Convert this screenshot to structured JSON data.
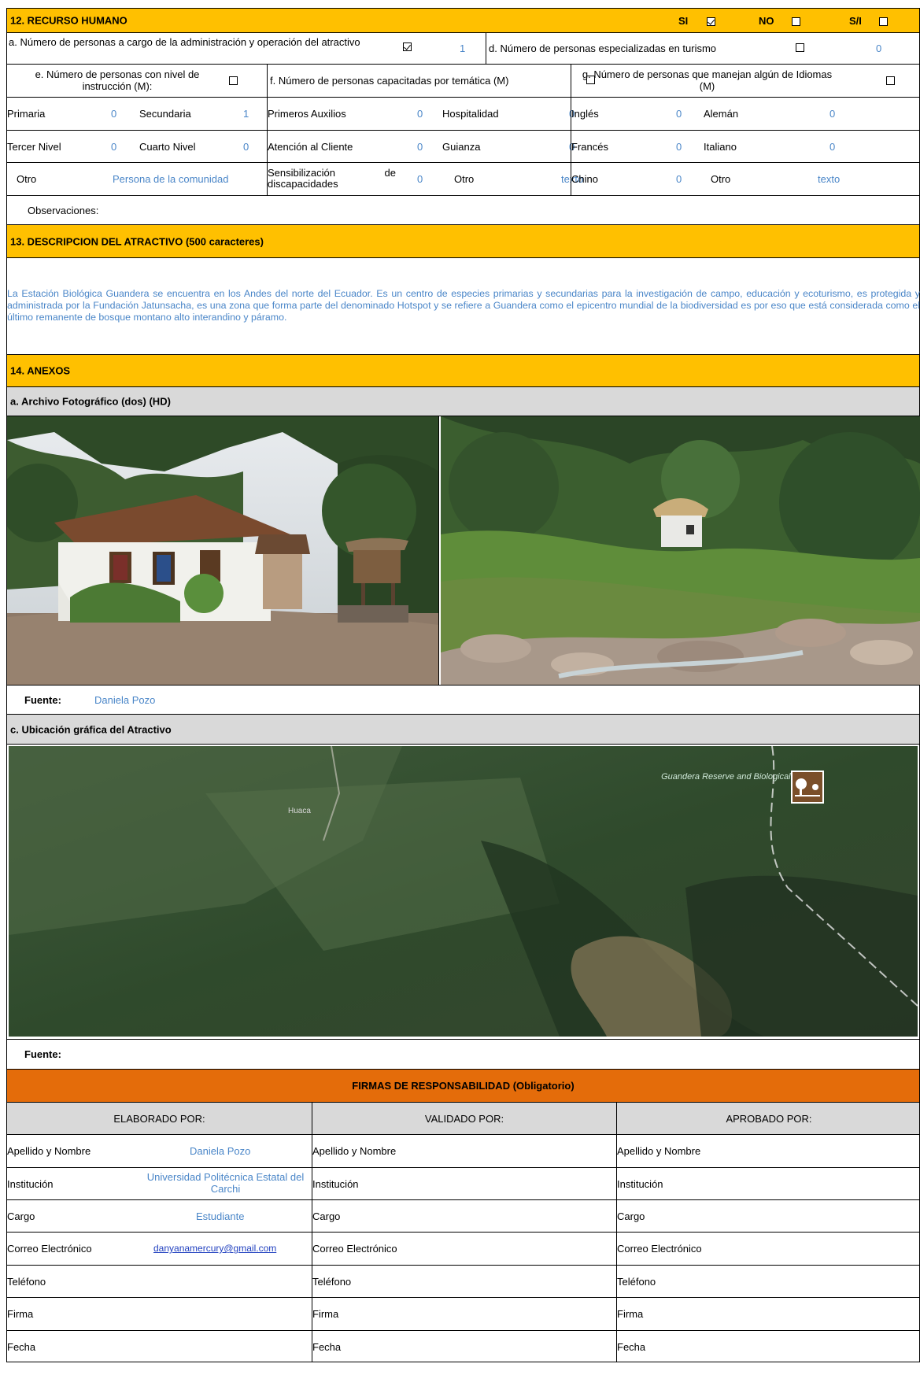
{
  "s12": {
    "title": "12. RECURSO HUMANO",
    "si": "SI",
    "no": "NO",
    "sn": "S/I",
    "a_label": "a. Número de personas a cargo de la administración y operación del atractivo",
    "a_value": "1",
    "d_label": "d. Número de personas especializadas en turismo",
    "d_value": "0",
    "e_label": "e. Número de personas con nivel de instrucción (M):",
    "f_label": "f. Número de personas capacitadas por temática (M)",
    "g_label": "g. Número de personas que manejan algún de Idiomas (M)",
    "rows": [
      [
        "Primaria",
        "0",
        "Secundaria",
        "1",
        "Primeros Auxilios",
        "0",
        "Hospitalidad",
        "0",
        "Inglés",
        "0",
        "Alemán",
        "0"
      ],
      [
        "Tercer Nivel",
        "0",
        "Cuarto Nivel",
        "0",
        "Atención al Cliente",
        "0",
        "Guianza",
        "0",
        "Francés",
        "0",
        "Italiano",
        "0"
      ],
      [
        "Otro",
        "Persona de la comunidad",
        "",
        "",
        "Sensibilización de discapacidades",
        "0",
        "Otro",
        "texto",
        "Chino",
        "0",
        "Otro",
        "texto"
      ]
    ],
    "observaciones": "Observaciones:"
  },
  "s13": {
    "title": "13. DESCRIPCION DEL ATRACTIVO (500 caracteres)",
    "text": "La Estación Biológica Guandera se encuentra en los Andes del norte del Ecuador. Es un centro de especies primarias y secundarias para la investigación de campo, educación y ecoturismo, es protegida y administrada por la Fundación Jatunsacha, es una zona que forma parte del denominado Hotspot  y se refiere a Guandera como el epicentro mundial de la biodiversidad es por eso que está considerada como el último remanente de bosque montano alto interandino y páramo."
  },
  "s14": {
    "title": "14. ANEXOS",
    "photo_title": "a. Archivo Fotográfico (dos) (HD)",
    "fuente_label": "Fuente:",
    "fuente_value": "Daniela Pozo",
    "map_title": "c. Ubicación gráfica del Atractivo",
    "map_town": "Huaca",
    "map_place": "Guandera Reserve and Biological Station",
    "fuente2_label": "Fuente:"
  },
  "firmas": {
    "title": "FIRMAS DE RESPONSABILIDAD (Obligatorio)",
    "cols": [
      "ELABORADO POR:",
      "VALIDADO  POR:",
      "APROBADO POR:"
    ],
    "labels": [
      "Apellido y Nombre",
      "Institución",
      "Cargo",
      "Correo Electrónico",
      "Teléfono",
      "Firma",
      "Fecha"
    ],
    "elaborado": {
      "nombre": "Daniela Pozo",
      "institucion": "Universidad Politécnica Estatal del Carchi",
      "cargo": "Estudiante",
      "correo": "danyanamercury@gmail.com"
    }
  },
  "colors": {
    "header": "#ffc000",
    "orange": "#e46c0a",
    "grey": "#d9d9d9",
    "value_blue": "#4a86c8"
  }
}
